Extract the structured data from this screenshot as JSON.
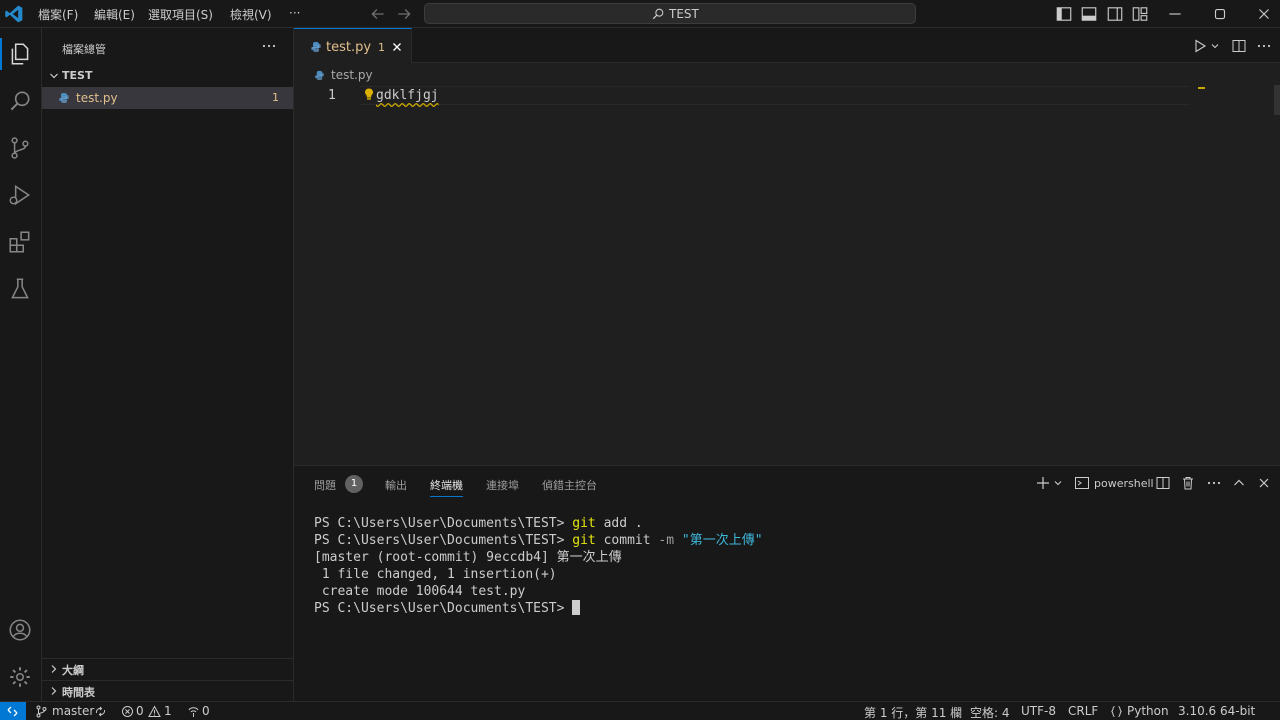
{
  "titlebar": {
    "menus": [
      "檔案(F)",
      "編輯(E)",
      "選取項目(S)",
      "檢視(V)",
      "···"
    ],
    "search": "TEST",
    "icons": [
      "vscode-logo-icon",
      "arrow-left-icon",
      "arrow-right-icon",
      "search-icon",
      "layout-sidebar-icon",
      "layout-panel-icon",
      "layout-secondary-icon",
      "layout-custom-icon",
      "minimize-icon",
      "restore-icon",
      "close-icon"
    ]
  },
  "activitybar": {
    "items": [
      "explorer-icon",
      "search-icon",
      "source-control-icon",
      "run-debug-icon",
      "extensions-icon",
      "testing-icon",
      "accounts-icon",
      "settings-gear-icon"
    ]
  },
  "sidebar": {
    "title": "檔案總管",
    "more": "···",
    "folder": "TEST",
    "file": {
      "name": "test.py",
      "badge": "1"
    },
    "outline": "大綱",
    "timeline": "時間表"
  },
  "editor": {
    "tab": {
      "name": "test.py",
      "badge": "1"
    },
    "breadcrumb": "test.py",
    "line_number": "1",
    "code": "gdklfjgj",
    "colors": {
      "warning": "#cca700",
      "accent": "#0078d4",
      "modified": "#e2c08d"
    }
  },
  "panel": {
    "tabs": [
      "問題",
      "輸出",
      "終端機",
      "連接埠",
      "偵錯主控台"
    ],
    "problems_badge": "1",
    "shell": "powershell",
    "terminal": {
      "prompt": "PS C:\\Users\\User\\Documents\\TEST> ",
      "cmd1": "git",
      "cmd1_rest": " add .",
      "cmd2": "git",
      "cmd2_mid": " commit ",
      "cmd2_flag": "-m",
      "cmd2_msg": " \"第一次上傳\"",
      "out1": "[master (root-commit) 9eccdb4] 第一次上傳",
      "out2": " 1 file changed, 1 insertion(+)",
      "out3": " create mode 100644 test.py"
    }
  },
  "statusbar": {
    "branch": "master",
    "errors": "0",
    "warnings": "1",
    "ports": "0",
    "position": "第 1 行，第 11 欄",
    "spaces": "空格: 4",
    "encoding": "UTF-8",
    "eol": "CRLF",
    "language": "Python",
    "interpreter": "3.10.6 64-bit"
  }
}
